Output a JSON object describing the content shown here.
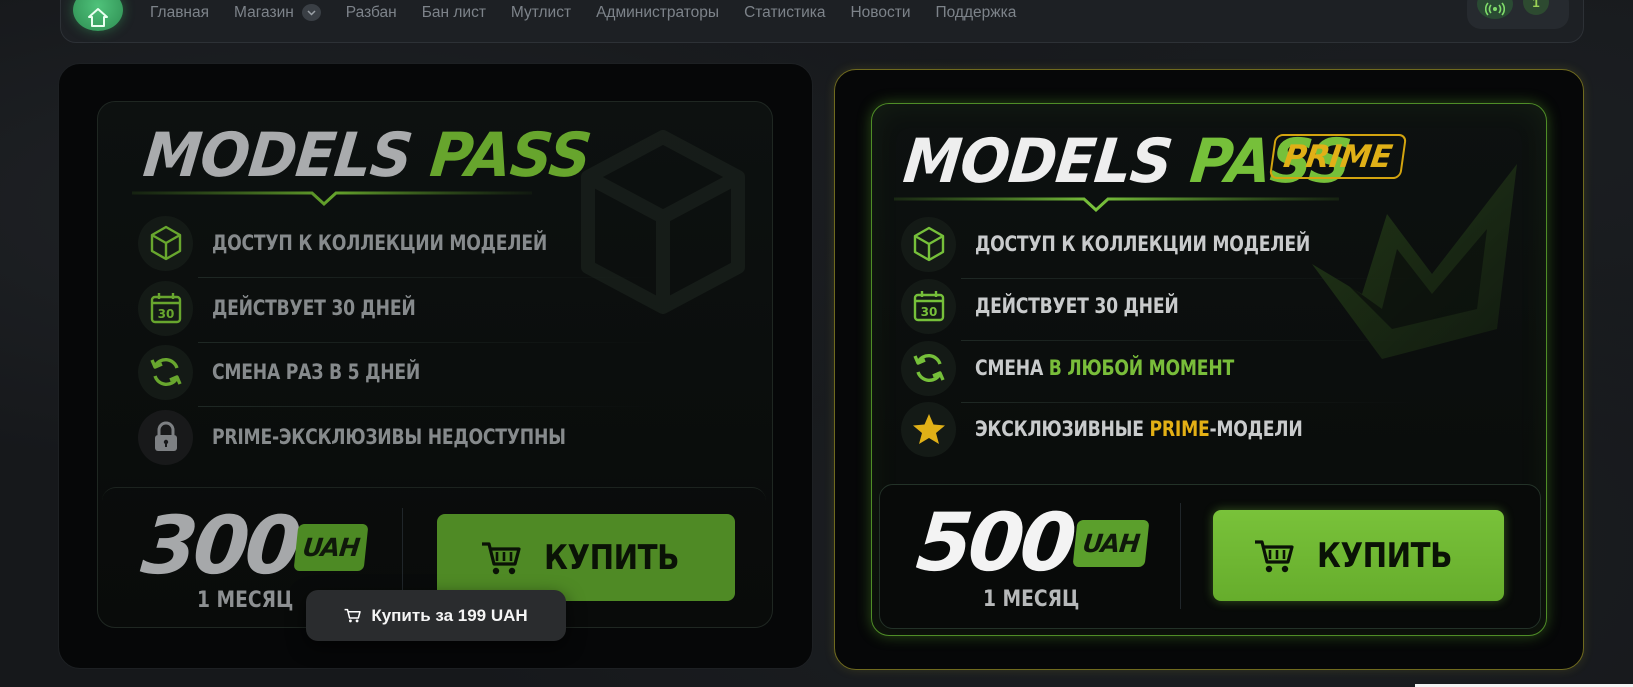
{
  "nav": {
    "items": [
      {
        "label": "Главная"
      },
      {
        "label": "Магазин",
        "has_dropdown": true
      },
      {
        "label": "Разбан"
      },
      {
        "label": "Бан лист"
      },
      {
        "label": "Мутлист"
      },
      {
        "label": "Администраторы"
      },
      {
        "label": "Статистика"
      },
      {
        "label": "Новости"
      },
      {
        "label": "Поддержка"
      }
    ],
    "online_count": "1",
    "icons": {
      "home": "home-icon",
      "online": "broadcast-icon",
      "dropdown": "chevron-down-icon"
    }
  },
  "plans": [
    {
      "title_word1": "MODELS",
      "title_word2": "PASS",
      "features": [
        {
          "icon": "cube-icon",
          "text": "ДОСТУП К КОЛЛЕКЦИИ МОДЕЛЕЙ"
        },
        {
          "icon": "calendar-30-icon",
          "text": "ДЕЙСТВУЕТ 30 ДНЕЙ"
        },
        {
          "icon": "refresh-icon",
          "text": "СМЕНА РАЗ В 5 ДНЕЙ"
        },
        {
          "icon": "lock-icon",
          "text": "PRIME-ЭКСКЛЮЗИВЫ НЕДОСТУПНЫ"
        }
      ],
      "price": "300",
      "currency": "UAH",
      "period": "1 МЕСЯЦ",
      "buy_label": "КУПИТЬ",
      "calendar_number": "30"
    },
    {
      "title_word1": "MODELS",
      "title_word2": "PASS",
      "badge": "PRIME",
      "features": [
        {
          "icon": "cube-icon",
          "text": "ДОСТУП К КОЛЛЕКЦИИ МОДЕЛЕЙ"
        },
        {
          "icon": "calendar-30-icon",
          "text": "ДЕЙСТВУЕТ 30 ДНЕЙ"
        },
        {
          "icon": "refresh-icon",
          "text_prefix": "СМЕНА ",
          "text_highlight": "В ЛЮБОЙ МОМЕНТ"
        },
        {
          "icon": "star-icon",
          "text_prefix": "ЭКСКЛЮЗИВНЫЕ ",
          "text_highlight": "PRIME",
          "text_suffix": "-МОДЕЛИ"
        }
      ],
      "price": "500",
      "currency": "UAH",
      "period": "1 МЕСЯЦ",
      "buy_label": "КУПИТЬ",
      "calendar_number": "30"
    }
  ],
  "tooltip": {
    "label": "Купить за 199 UAH",
    "icon": "cart-icon"
  },
  "colors": {
    "accent_green": "#76c03a",
    "dark_green": "#4f8a25",
    "prime_gold": "#e0b017",
    "background": "#16181b"
  }
}
